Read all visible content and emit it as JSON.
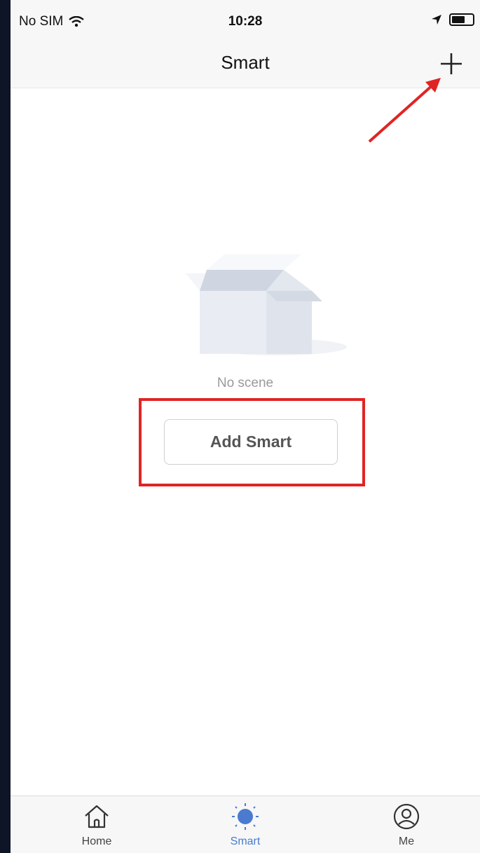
{
  "status_bar": {
    "carrier": "No SIM",
    "time": "10:28"
  },
  "nav": {
    "title": "Smart"
  },
  "empty_state": {
    "message": "No scene",
    "button_label": "Add Smart"
  },
  "tabs": [
    {
      "label": "Home",
      "icon": "home-icon",
      "active": false
    },
    {
      "label": "Smart",
      "icon": "smart-sun-icon",
      "active": true
    },
    {
      "label": "Me",
      "icon": "profile-icon",
      "active": false
    }
  ],
  "colors": {
    "accent": "#4a7bd0",
    "annotation": "#e02424",
    "background": "#ffffff",
    "bar_background": "#f7f7f7"
  }
}
